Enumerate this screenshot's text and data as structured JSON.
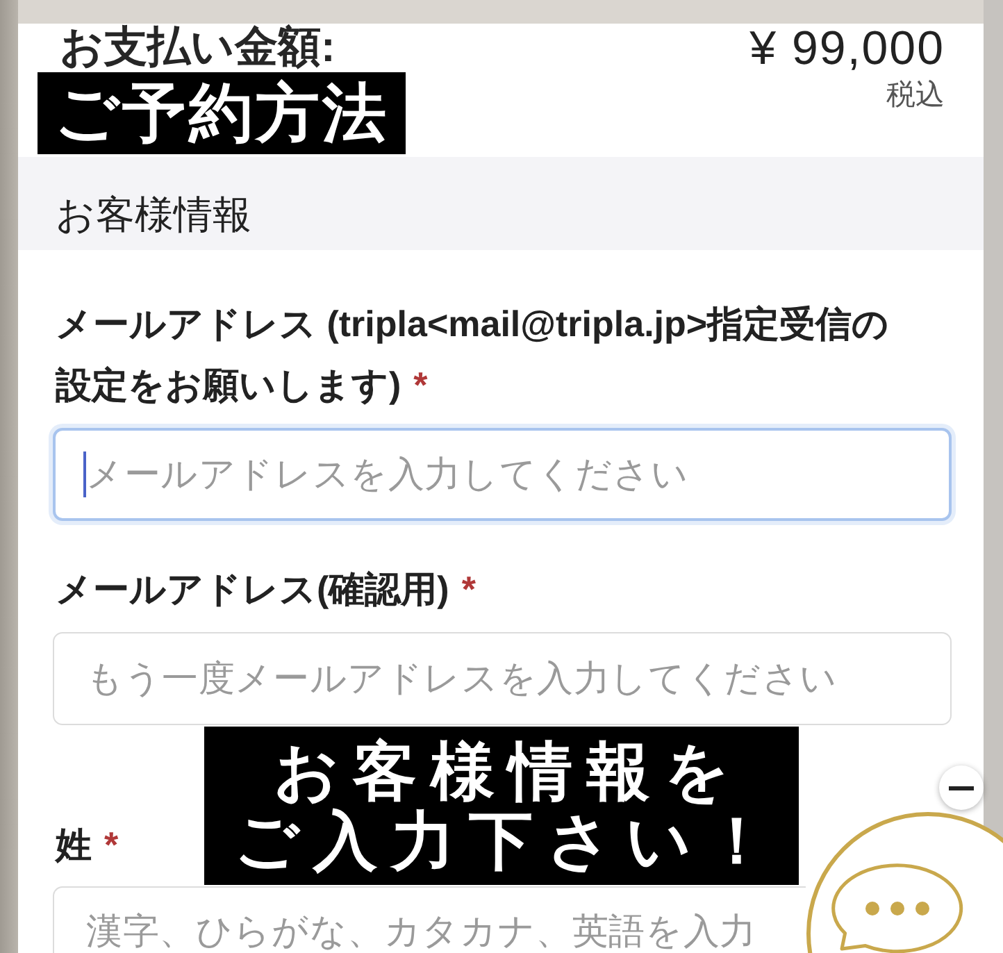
{
  "payment": {
    "label": "お支払い金額:",
    "amount": "¥ 99,000",
    "tax_note": "税込"
  },
  "captions": [
    {
      "lines": [
        "ご予約方法"
      ]
    },
    {
      "lines": [
        "お客様情報を",
        "ご入力下さい！"
      ]
    }
  ],
  "section": {
    "title": "お客様情報"
  },
  "fields": [
    {
      "label": "メールアドレス (tripla<mail@tripla.jp>指定受信の設定をお願いします)",
      "required_mark": "*",
      "placeholder": "メールアドレスを入力してください",
      "focused": true
    },
    {
      "label": "メールアドレス(確認用)",
      "required_mark": "*",
      "placeholder": "もう一度メールアドレスを入力してください",
      "focused": false
    },
    {
      "label": "姓",
      "required_mark": "*",
      "placeholder": "漢字、ひらがな、カタカナ、英語を入力",
      "focused": false
    }
  ]
}
